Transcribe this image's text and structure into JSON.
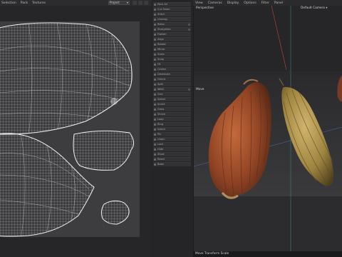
{
  "uv_editor": {
    "menu": [
      "Selection",
      "Pack",
      "Textures"
    ],
    "project_select": "Project"
  },
  "commands": [
    {
      "label": "Pack All",
      "option": false
    },
    {
      "label": "Cut Seam",
      "option": false
    },
    {
      "label": "Stitch",
      "option": false
    },
    {
      "label": "Unwrap",
      "option": false
    },
    {
      "label": "Relax",
      "option": true
    },
    {
      "label": "Straighten",
      "option": true
    },
    {
      "label": "Flatten",
      "option": false
    },
    {
      "label": "Align",
      "option": false
    },
    {
      "label": "Rotate",
      "option": false
    },
    {
      "label": "Mirror",
      "option": false
    },
    {
      "label": "Scale",
      "option": false
    },
    {
      "label": "Snap",
      "option": false
    },
    {
      "label": "Fit",
      "option": false
    },
    {
      "label": "Center",
      "option": false
    },
    {
      "label": "Distribute",
      "option": false
    },
    {
      "label": "Orient",
      "option": false
    },
    {
      "label": "Split",
      "option": false
    },
    {
      "label": "Weld",
      "option": true
    },
    {
      "label": "Grid",
      "option": false
    },
    {
      "label": "Select",
      "option": false
    },
    {
      "label": "Invert",
      "option": false
    },
    {
      "label": "Grow",
      "option": false
    },
    {
      "label": "Shrink",
      "option": false
    },
    {
      "label": "Loop",
      "option": false
    },
    {
      "label": "Ring",
      "option": false
    },
    {
      "label": "Island",
      "option": false
    },
    {
      "label": "Pin",
      "option": false
    },
    {
      "label": "Unpin",
      "option": false
    },
    {
      "label": "Lock",
      "option": false
    },
    {
      "label": "Hide",
      "option": false
    },
    {
      "label": "Show",
      "option": false
    },
    {
      "label": "Reset",
      "option": false
    },
    {
      "label": "Bake",
      "option": false
    }
  ],
  "viewport": {
    "menu": [
      "View",
      "Cameras",
      "Display",
      "Options",
      "Filter",
      "Panel"
    ],
    "label_projection": "Perspective",
    "label_camera": "Default Camera",
    "label_move": "Move",
    "status": "Move Transform Scale"
  },
  "colors": {
    "uv_wire": "#e6e6e6",
    "uv_bg": "#3d3d3f",
    "seed_orange": "#a3512b",
    "seed_yellow": "#a88c46"
  }
}
